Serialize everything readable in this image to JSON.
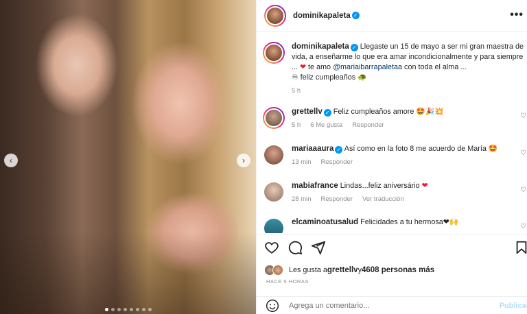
{
  "post": {
    "author": "dominikapaleta",
    "more_label": "•••"
  },
  "caption": {
    "username": "dominikapaleta",
    "text_before": "Llegaste un 15 de mayo a ser mi gran maestra de vida, a enseñarme lo que era amar incondicionalmente y para siempre ... ",
    "heart": "❤",
    "text_mid": " te amo ",
    "mention": "@mariaibarrapaletaa",
    "text_after": " con toda el alma ...",
    "line2": "♾ feliz cumpleaños 🐢",
    "time": "5 h"
  },
  "comments": [
    {
      "username": "grettellv",
      "verified": true,
      "text": "Feliz cumpleaños amore 🤩🎉💥",
      "time": "5 h",
      "likes": "6 Me gusta",
      "reply": "Responder",
      "translate": ""
    },
    {
      "username": "mariaaaura",
      "verified": true,
      "text": "Así como en la foto 8 me acuerdo de María 🤩",
      "time": "13 min",
      "likes": "",
      "reply": "Responder",
      "translate": ""
    },
    {
      "username": "mabiafrance",
      "verified": false,
      "text": "Lindas...feliz aniversário ",
      "heart": "❤",
      "time": "28 min",
      "likes": "",
      "reply": "Responder",
      "translate": "Ver traducción"
    },
    {
      "username": "elcaminoatusalud",
      "verified": false,
      "text": "Felicidades a tu hermosa❤🙌",
      "time": "",
      "likes": "",
      "reply": "",
      "translate": ""
    }
  ],
  "likes": {
    "prefix": "Les gusta a ",
    "user": "grettellv",
    "mid": " y ",
    "count": "4608 personas más"
  },
  "posted_time": "HACE 5 HORAS",
  "add_comment": {
    "placeholder": "Agrega un comentario...",
    "publish_label": "Publicar"
  },
  "carousel": {
    "prev": "‹",
    "next": "›",
    "slides": 8,
    "active_slide": 1
  },
  "colors": {
    "accent": "#0095f6",
    "heart": "#ed1c3b",
    "mention": "#00376b"
  }
}
